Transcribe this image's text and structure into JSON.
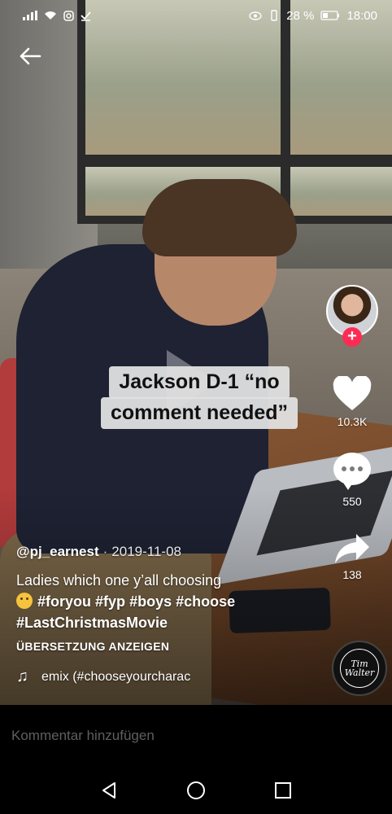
{
  "status_bar": {
    "battery_percent": "28 %",
    "time": "18:00"
  },
  "video": {
    "overlay_text_line1": "Jackson D-1 “no",
    "overlay_text_line2": "comment needed”"
  },
  "side_rail": {
    "likes": "10.3K",
    "comments": "550",
    "shares": "138",
    "music_disc_text": "Tim Walter"
  },
  "post": {
    "author": "@pj_earnest",
    "separator": "·",
    "date": "2019-11-08",
    "description": "Ladies which one y’all choosing",
    "hashtags": [
      "#foryou",
      "#fyp",
      "#boys",
      "#choose",
      "#LastChristmasMovie"
    ],
    "translate_label": "ÜBERSETZUNG ANZEIGEN",
    "music": "emix (#chooseyourcharac"
  },
  "comment_bar": {
    "placeholder": "Kommentar hinzufügen"
  },
  "colors": {
    "accent": "#fe2c55",
    "caption_bg": "#e1e1e1"
  }
}
